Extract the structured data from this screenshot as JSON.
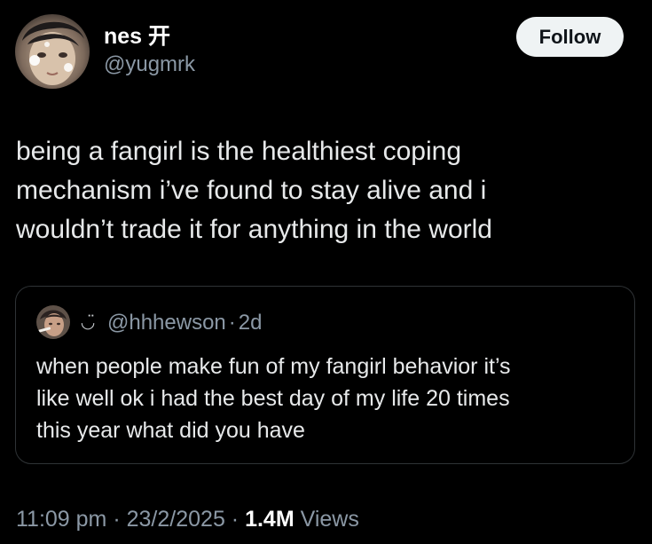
{
  "author": {
    "display_name": "nes 开",
    "handle": "@yugmrk"
  },
  "follow_label": "Follow",
  "tweet": {
    "text": "being a fangirl is the healthiest coping\nmechanism i’ve found to stay alive and i\nwouldn’t trade it for anything in the world"
  },
  "quote": {
    "emoji": "◡̈",
    "handle": "@hhhewson",
    "separator": "·",
    "age": "2d",
    "text": "when people make fun of my fangirl behavior it’s\nlike well ok i had the best day of my life 20 times\nthis year what did you have"
  },
  "meta": {
    "time": "11:09 pm",
    "separator": "·",
    "date": "23/2/2025",
    "views_count": "1.4M",
    "views_label": "Views"
  },
  "colors": {
    "background": "#000000",
    "text": "#e7e9ea",
    "muted": "#8b98a5",
    "follow_bg": "#eff3f4"
  },
  "icons": {
    "avatar": "profile-photo-icon",
    "quote_avatar": "profile-photo-icon",
    "smiley": "smiley-icon"
  }
}
